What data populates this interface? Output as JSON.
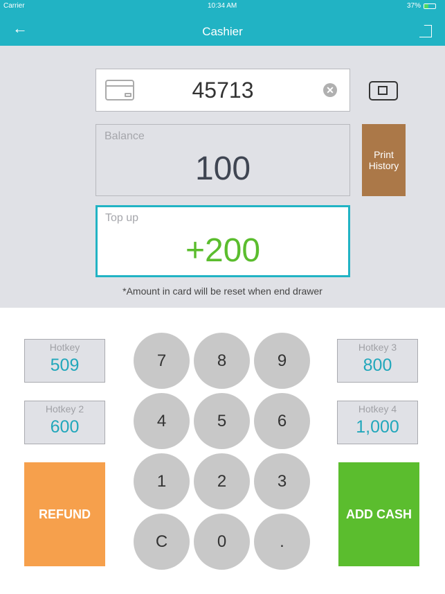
{
  "status": {
    "carrier": "Carrier",
    "time": "10:34 AM",
    "battery": "37%"
  },
  "nav": {
    "title": "Cashier"
  },
  "card": {
    "number": "45713"
  },
  "balance": {
    "label": "Balance",
    "value": "100"
  },
  "print_history": "Print History",
  "topup": {
    "label": "Top up",
    "value": "+200"
  },
  "note": "*Amount in card will be reset when end drawer",
  "hotkeys": [
    {
      "label": "Hotkey",
      "value": "509"
    },
    {
      "label": "Hotkey 2",
      "value": "600"
    },
    {
      "label": "Hotkey 3",
      "value": "800"
    },
    {
      "label": "Hotkey 4",
      "value": "1,000"
    }
  ],
  "keys": [
    "7",
    "8",
    "9",
    "4",
    "5",
    "6",
    "1",
    "2",
    "3",
    "C",
    "0",
    "."
  ],
  "refund": "REFUND",
  "add_cash": "ADD CASH",
  "colors": {
    "accent": "#21b3c4",
    "refund": "#f6a04c",
    "add_cash": "#5bbd2e",
    "print": "#ab7848",
    "topup": "#5bbd2e"
  }
}
